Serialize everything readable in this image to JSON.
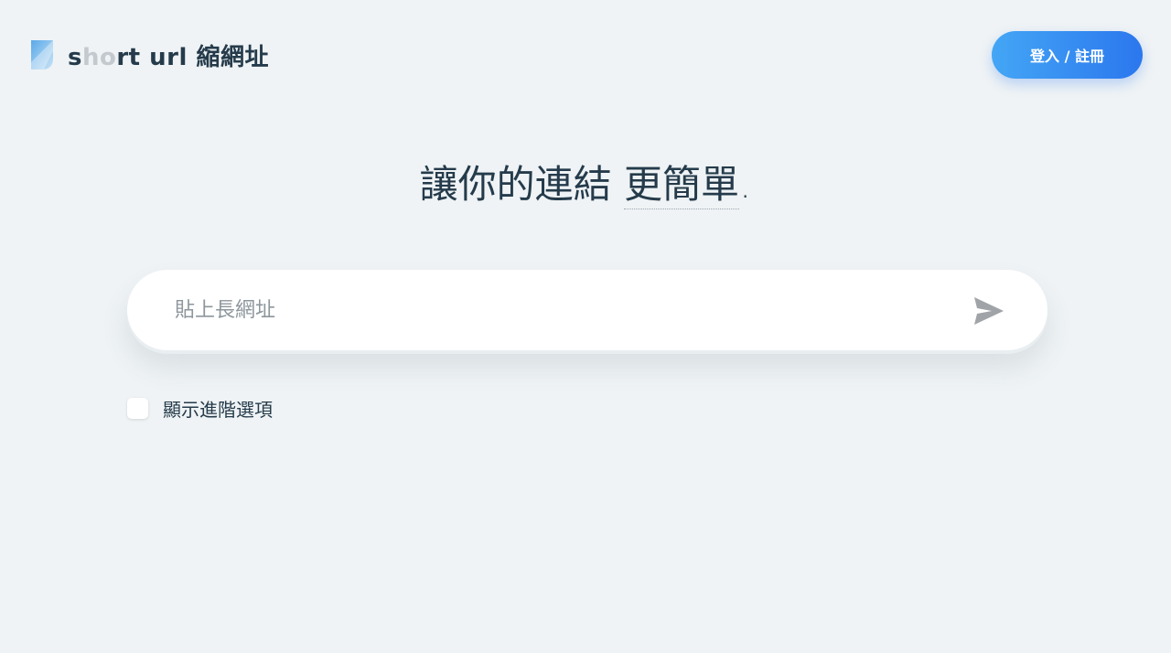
{
  "header": {
    "logo_text_s": "s",
    "logo_text_faded": "ho",
    "logo_text_rest": "rt url 縮網址",
    "login_label": "登入 / 註冊"
  },
  "hero": {
    "title_main": "讓你的連結 ",
    "title_accent": "更簡單",
    "title_end": "."
  },
  "url_form": {
    "placeholder": "貼上長網址",
    "value": "",
    "submit_icon": "send-icon"
  },
  "advanced": {
    "checked": false,
    "label": "顯示進階選項"
  },
  "colors": {
    "background": "#eff3f5",
    "text": "#253b4b",
    "accent_start": "#44a6f5",
    "accent_end": "#2b77ee",
    "icon_grey": "#a0a4a8"
  }
}
